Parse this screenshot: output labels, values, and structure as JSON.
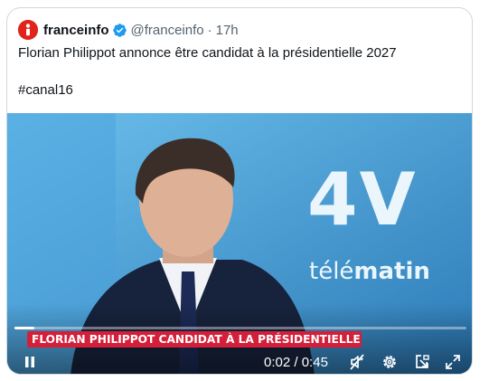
{
  "tweet": {
    "display_name": "franceinfo",
    "handle": "@franceinfo",
    "separator": "·",
    "time": "17h",
    "text": "Florian Philippot annonce être candidat à la présidentielle 2027",
    "hashtag": "#canal16"
  },
  "video": {
    "logo_main": "4V",
    "logo_sub_regular": "télé",
    "logo_sub_bold": "matin",
    "banner": "FLORIAN PHILIPPOT CANDIDAT À LA PRÉSIDENTIELLE",
    "time_current": "0:02",
    "time_total": "0:45",
    "time_separator": " / ",
    "progress_fraction": 0.044
  },
  "icons": {
    "avatar": "franceinfo-logo-icon",
    "verified": "verified-badge-icon",
    "pause": "pause-icon",
    "mute": "muted-speaker-icon",
    "settings": "gear-icon",
    "pip": "picture-in-picture-icon",
    "fullscreen": "fullscreen-icon"
  },
  "colors": {
    "brand_red": "#e2231a",
    "verified_blue": "#1d9bf0",
    "banner_red": "#d41f3a",
    "text_primary": "#0f1419",
    "text_secondary": "#536471"
  }
}
